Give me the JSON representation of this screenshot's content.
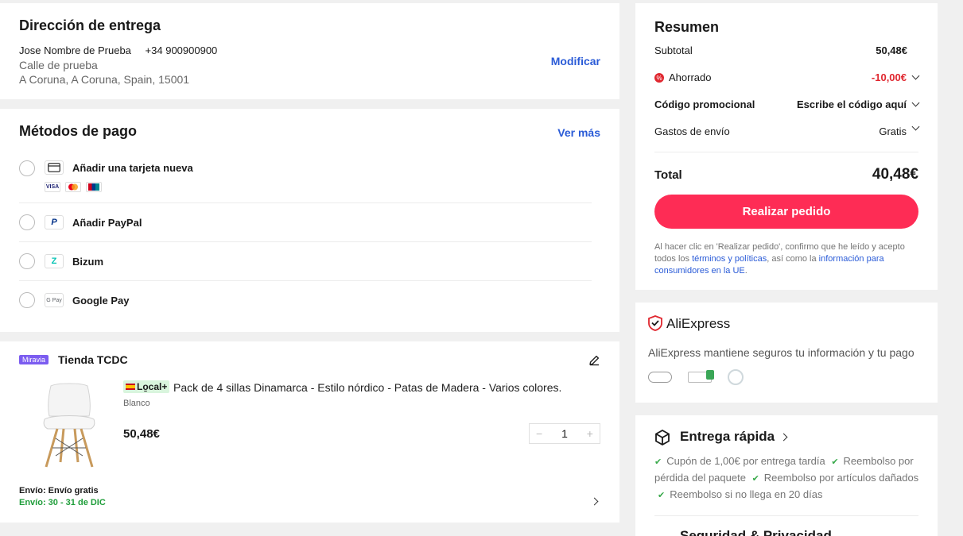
{
  "address": {
    "title": "Dirección de entrega",
    "name": "Jose Nombre de Prueba",
    "phone": "+34 900900900",
    "street": "Calle de prueba",
    "city": "A Coruna, A Coruna, Spain, 15001",
    "modify_label": "Modificar"
  },
  "payment": {
    "title": "Métodos de pago",
    "see_more_label": "Ver más",
    "methods": [
      {
        "label": "Añadir una tarjeta nueva",
        "icon": "card-icon"
      },
      {
        "label": "Añadir PayPal",
        "icon": "paypal-icon"
      },
      {
        "label": "Bizum",
        "icon": "bizum-icon"
      },
      {
        "label": "Google Pay",
        "icon": "google-pay-icon"
      }
    ],
    "card_brands": [
      "VISA",
      "MC",
      "UP"
    ],
    "gpay_text": "G Pay",
    "paypal_text": "P",
    "bizum_text": "Z"
  },
  "store": {
    "badge": "Miravia",
    "name": "Tienda TCDC",
    "product": {
      "local_tag": "Lo̱cal+",
      "title": "Pack de 4 sillas Dinamarca - Estilo nórdico - Patas de Madera - Varios colores.",
      "variant": "Blanco",
      "price": "50,48€",
      "quantity": "1",
      "minus": "−",
      "plus": "+"
    },
    "shipping_label": "Envío: Envío gratis",
    "delivery_label": "Envío: 30 - 31 de DIC"
  },
  "summary": {
    "title": "Resumen",
    "subtotal_label": "Subtotal",
    "subtotal_value": "50,48€",
    "saved_label": "Ahorrado",
    "saved_value": "-10,00€",
    "promo_label": "Código promocional",
    "promo_value": "Escribe el código aquí",
    "shipping_label": "Gastos de envío",
    "shipping_value": "Gratis",
    "total_label": "Total",
    "total_value": "40,48€",
    "order_button": "Realizar pedido",
    "legal_1": "Al hacer clic en 'Realizar pedido', confirmo que he leído y acepto todos los ",
    "legal_link_1": "términos y políticas",
    "legal_2": ", así como la ",
    "legal_link_2": "información para consumidores en la UE",
    "legal_3": "."
  },
  "trust": {
    "brand": "AliExpress",
    "text": "AliExpress mantiene seguros tu información y tu pago"
  },
  "fast_delivery": {
    "title": "Entrega rápida",
    "items": [
      "Cupón de 1,00€ por entrega tardía",
      "Reembolso por pérdida del paquete",
      "Reembolso por artículos dañados",
      "Reembolso si no llega en 20 días"
    ],
    "next_title": "Seguridad & Privacidad"
  },
  "colors": {
    "accent": "#fe2c55",
    "link": "#2a5bd7",
    "green": "#1f9d3a",
    "saved": "#e0272f"
  }
}
